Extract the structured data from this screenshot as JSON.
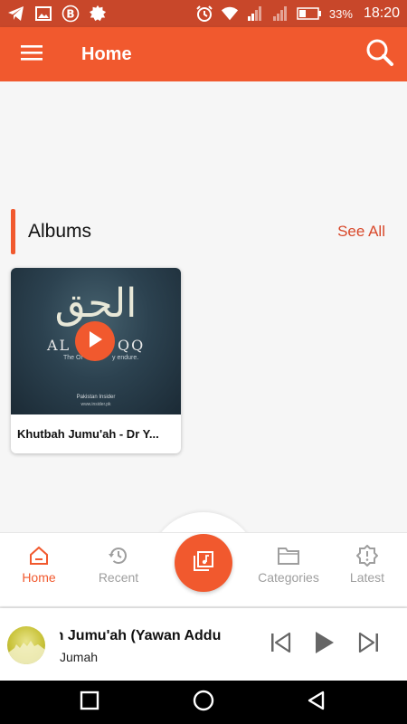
{
  "colors": {
    "primary": "#f1592e",
    "status_bar": "#c8472a",
    "accent_text": "#d8482a",
    "inactive": "#9e9e9e"
  },
  "status_bar": {
    "icons": [
      "telegram-icon",
      "image-icon",
      "bitcoin-icon",
      "app-badge-icon",
      "alarm-icon",
      "wifi-icon",
      "signal-icon",
      "signal-icon",
      "battery-icon"
    ],
    "battery": "33%",
    "time": "18:20"
  },
  "app_bar": {
    "title": "Home",
    "menu_icon": "hamburger-icon",
    "search_icon": "search-icon"
  },
  "albums": {
    "title": "Albums",
    "see_all": "See All",
    "items": [
      {
        "title": "Khutbah Jumu'ah - Dr Y...",
        "art": {
          "calligraphy": "الحق",
          "line1_left": "AL",
          "line1_right": "QQ",
          "line2_left": "The Or",
          "line2_right": "y endure.",
          "credit_1": "Pakistan Insider",
          "credit_2": "www.insider.pk"
        }
      }
    ]
  },
  "bottom_nav": {
    "items": [
      {
        "label": "Home",
        "icon": "home-icon",
        "active": true
      },
      {
        "label": "Recent",
        "icon": "history-icon",
        "active": false
      },
      {
        "label": "Categories",
        "icon": "folder-icon",
        "active": false
      },
      {
        "label": "Latest",
        "icon": "latest-badge-icon",
        "active": false
      }
    ],
    "center_icon": "library-music-icon"
  },
  "mini_player": {
    "title": "bah Jumu'ah (Yawan Addu",
    "subtitle": "Jumah",
    "controls": [
      "skip-previous-icon",
      "play-icon",
      "skip-next-icon"
    ]
  },
  "system_nav": [
    "recents-square-icon",
    "home-circle-icon",
    "back-triangle-icon"
  ]
}
